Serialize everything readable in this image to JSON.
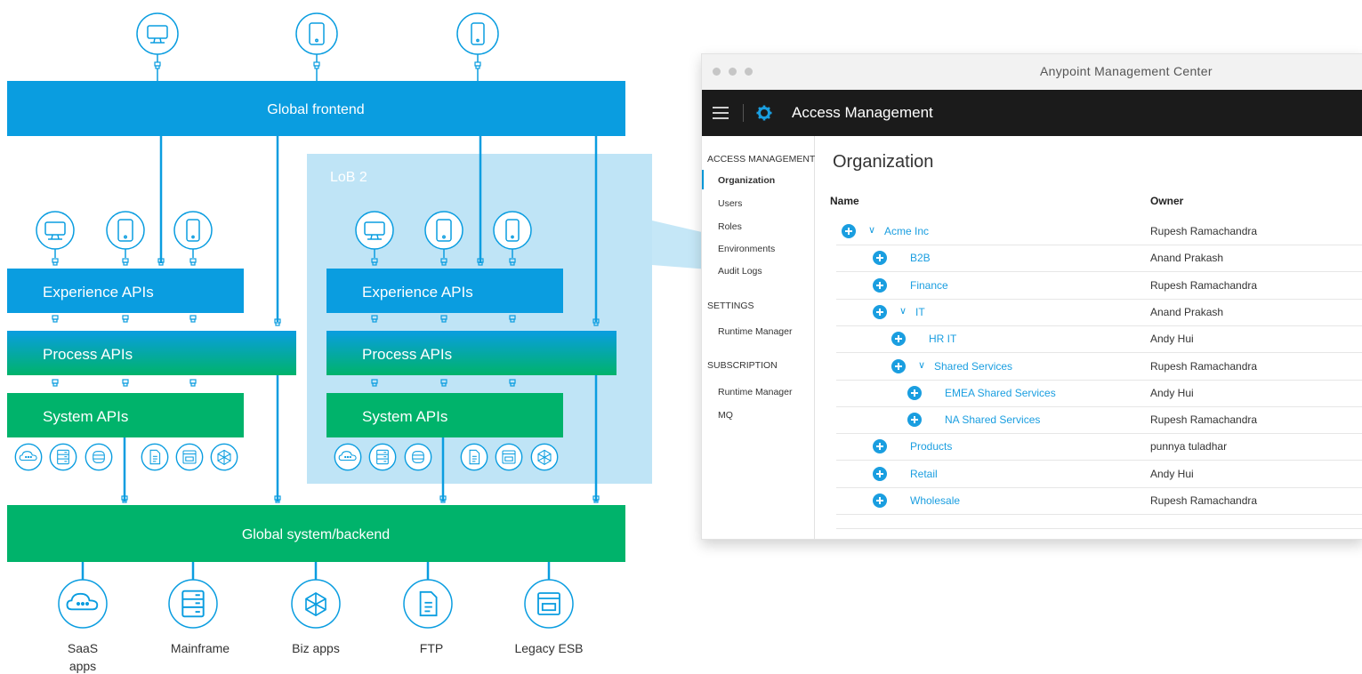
{
  "diagram": {
    "global_frontend": "Global frontend",
    "global_backend": "Global system/backend",
    "lob_label": "LoB 2",
    "experience_apis": "Experience APIs",
    "process_apis": "Process APIs",
    "system_apis": "System APIs",
    "systems": [
      {
        "label": "SaaS",
        "label2": "apps",
        "icon": "cloud-icon"
      },
      {
        "label": "Mainframe",
        "label2": "",
        "icon": "server-icon"
      },
      {
        "label": "Biz apps",
        "label2": "",
        "icon": "cube-icon"
      },
      {
        "label": "FTP",
        "label2": "",
        "icon": "document-icon"
      },
      {
        "label": "Legacy ESB",
        "label2": "",
        "icon": "esb-window-icon"
      }
    ],
    "colors": {
      "blue": "#0a9de0",
      "green": "#00b36b",
      "lob_bg": "#bfe4f6",
      "icon_line": "#0a9de0"
    }
  },
  "window": {
    "title": "Anypoint Management Center",
    "app_title": "Access Management",
    "sidebar": {
      "heading1": "ACCESS MANAGEMENT",
      "items1": [
        "Organization",
        "Users",
        "Roles",
        "Environments",
        "Audit Logs"
      ],
      "heading2": "SETTINGS",
      "items2": [
        "Runtime Manager"
      ],
      "heading3": "SUBSCRIPTION",
      "items3": [
        "Runtime Manager",
        "MQ"
      ]
    },
    "page_title": "Organization",
    "columns": {
      "name": "Name",
      "owner": "Owner"
    },
    "rows": [
      {
        "name": "Acme Inc",
        "owner": "Rupesh Ramachandra",
        "level": 0,
        "expanded": true
      },
      {
        "name": "B2B",
        "owner": "Anand Prakash",
        "level": 1,
        "expanded": false
      },
      {
        "name": "Finance",
        "owner": "Rupesh Ramachandra",
        "level": 1,
        "expanded": false
      },
      {
        "name": "IT",
        "owner": "Anand Prakash",
        "level": 1,
        "expanded": true
      },
      {
        "name": "HR IT",
        "owner": "Andy Hui",
        "level": 2,
        "expanded": false
      },
      {
        "name": "Shared Services",
        "owner": "Rupesh Ramachandra",
        "level": 2,
        "expanded": true
      },
      {
        "name": "EMEA Shared Services",
        "owner": "Andy Hui",
        "level": 3,
        "expanded": false
      },
      {
        "name": "NA Shared Services",
        "owner": "Rupesh Ramachandra",
        "level": 3,
        "expanded": false
      },
      {
        "name": "Products",
        "owner": "punnya tuladhar",
        "level": 1,
        "expanded": false
      },
      {
        "name": "Retail",
        "owner": "Andy Hui",
        "level": 1,
        "expanded": false
      },
      {
        "name": "Wholesale",
        "owner": "Rupesh Ramachandra",
        "level": 1,
        "expanded": false
      }
    ]
  }
}
